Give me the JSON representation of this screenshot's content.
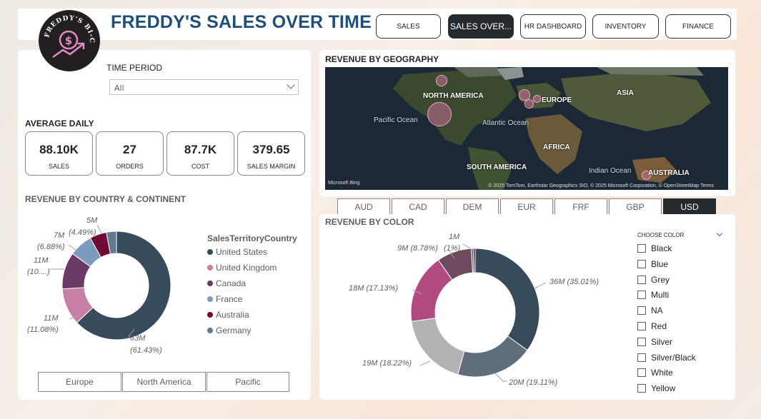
{
  "header": {
    "title": "FREDDY'S SALES OVER TIME",
    "logo_text": "FREDDY'S BI-CYCLE",
    "nav": [
      "SALES",
      "SALES OVER...",
      "HR DASHBOARD",
      "INVENTORY",
      "FINANCE"
    ],
    "active_nav": "SALES OVER..."
  },
  "time_period": {
    "label": "TIME PERIOD",
    "value": "All"
  },
  "average_daily": {
    "title": "AVERAGE DAILY",
    "kpis": [
      {
        "value": "88.10K",
        "label": "SALES"
      },
      {
        "value": "27",
        "label": "ORDERS"
      },
      {
        "value": "87.7K",
        "label": "COST"
      },
      {
        "value": "379.65",
        "label": "SALES MARGIN"
      }
    ]
  },
  "country_chart": {
    "title": "REVENUE BY COUNTRY & CONTINENT",
    "legend_title": "SalesTerritoryCountry",
    "legend": [
      {
        "name": "United States",
        "color": "#374b5c"
      },
      {
        "name": "United Kingdom",
        "color": "#c87fa5"
      },
      {
        "name": "Canada",
        "color": "#6b3a66"
      },
      {
        "name": "France",
        "color": "#7c9cbd"
      },
      {
        "name": "Australia",
        "color": "#6e0a33"
      },
      {
        "name": "Germany",
        "color": "#5f7a93"
      }
    ],
    "labels": [
      {
        "value": "63M",
        "pct": "(61.43%)"
      },
      {
        "value": "11M",
        "pct": "(11.08%)"
      },
      {
        "value": "11M",
        "pct": "(10....)"
      },
      {
        "value": "7M",
        "pct": "(6.88%)"
      },
      {
        "value": "5M",
        "pct": "(4.49%)"
      }
    ]
  },
  "continent_slicer": [
    "Europe",
    "North America",
    "Pacific"
  ],
  "geo_map": {
    "title": "REVENUE BY GEOGRAPHY",
    "labels": [
      "NORTH AMERICA",
      "EUROPE",
      "ASIA",
      "AFRICA",
      "SOUTH AMERICA",
      "AUSTRALIA"
    ],
    "oceans": [
      "Pacific Ocean",
      "Atlantic Ocean",
      "Indian Ocean"
    ],
    "credit": "© 2025 TomTom, Earthstar Geographics SIO, © 2025 Microsoft Corporation, © OpenStreetMap  Terms",
    "bing": "Microsoft Bing"
  },
  "currencies": [
    "AUD",
    "CAD",
    "DEM",
    "EUR",
    "FRF",
    "GBP",
    "USD"
  ],
  "active_currency": "USD",
  "color_chart": {
    "title": "REVENUE BY COLOR",
    "labels": [
      {
        "value": "36M",
        "pct": "(35.01%)"
      },
      {
        "value": "20M",
        "pct": "(19.11%)"
      },
      {
        "value": "19M",
        "pct": "(18.22%)"
      },
      {
        "value": "18M",
        "pct": "(17.13%)"
      },
      {
        "value": "9M",
        "pct": "(8.78%)"
      },
      {
        "value": "1M",
        "pct": "(1%)"
      }
    ],
    "slice_colors": [
      "#374b5c",
      "#5f6e7a",
      "#b3b3b3",
      "#b24b82",
      "#6e4a5e",
      "#3c5a72",
      "#6e0a33"
    ]
  },
  "color_filter": {
    "title": "CHOOSE COLOR",
    "options": [
      "Black",
      "Blue",
      "Grey",
      "Multi",
      "NA",
      "Red",
      "Silver",
      "Silver/Black",
      "White",
      "Yellow"
    ]
  },
  "chart_data": [
    {
      "type": "pie",
      "title": "REVENUE BY COUNTRY & CONTINENT",
      "categories": [
        "United States",
        "United Kingdom",
        "Canada",
        "France",
        "Australia",
        "Germany"
      ],
      "values": [
        63,
        11,
        11,
        7,
        5,
        3
      ],
      "percent": [
        61.43,
        11.08,
        10.8,
        6.88,
        4.49,
        3.1
      ],
      "unit": "M"
    },
    {
      "type": "pie",
      "title": "REVENUE BY COLOR",
      "categories": [
        "Black",
        "Grey",
        "Silver",
        "Red",
        "Multi",
        "Blue",
        "Yellow"
      ],
      "values": [
        36,
        20,
        19,
        18,
        9,
        0.5,
        0.5
      ],
      "percent": [
        35.01,
        19.11,
        18.22,
        17.13,
        8.78,
        0.9,
        0.85
      ],
      "unit": "M"
    }
  ]
}
